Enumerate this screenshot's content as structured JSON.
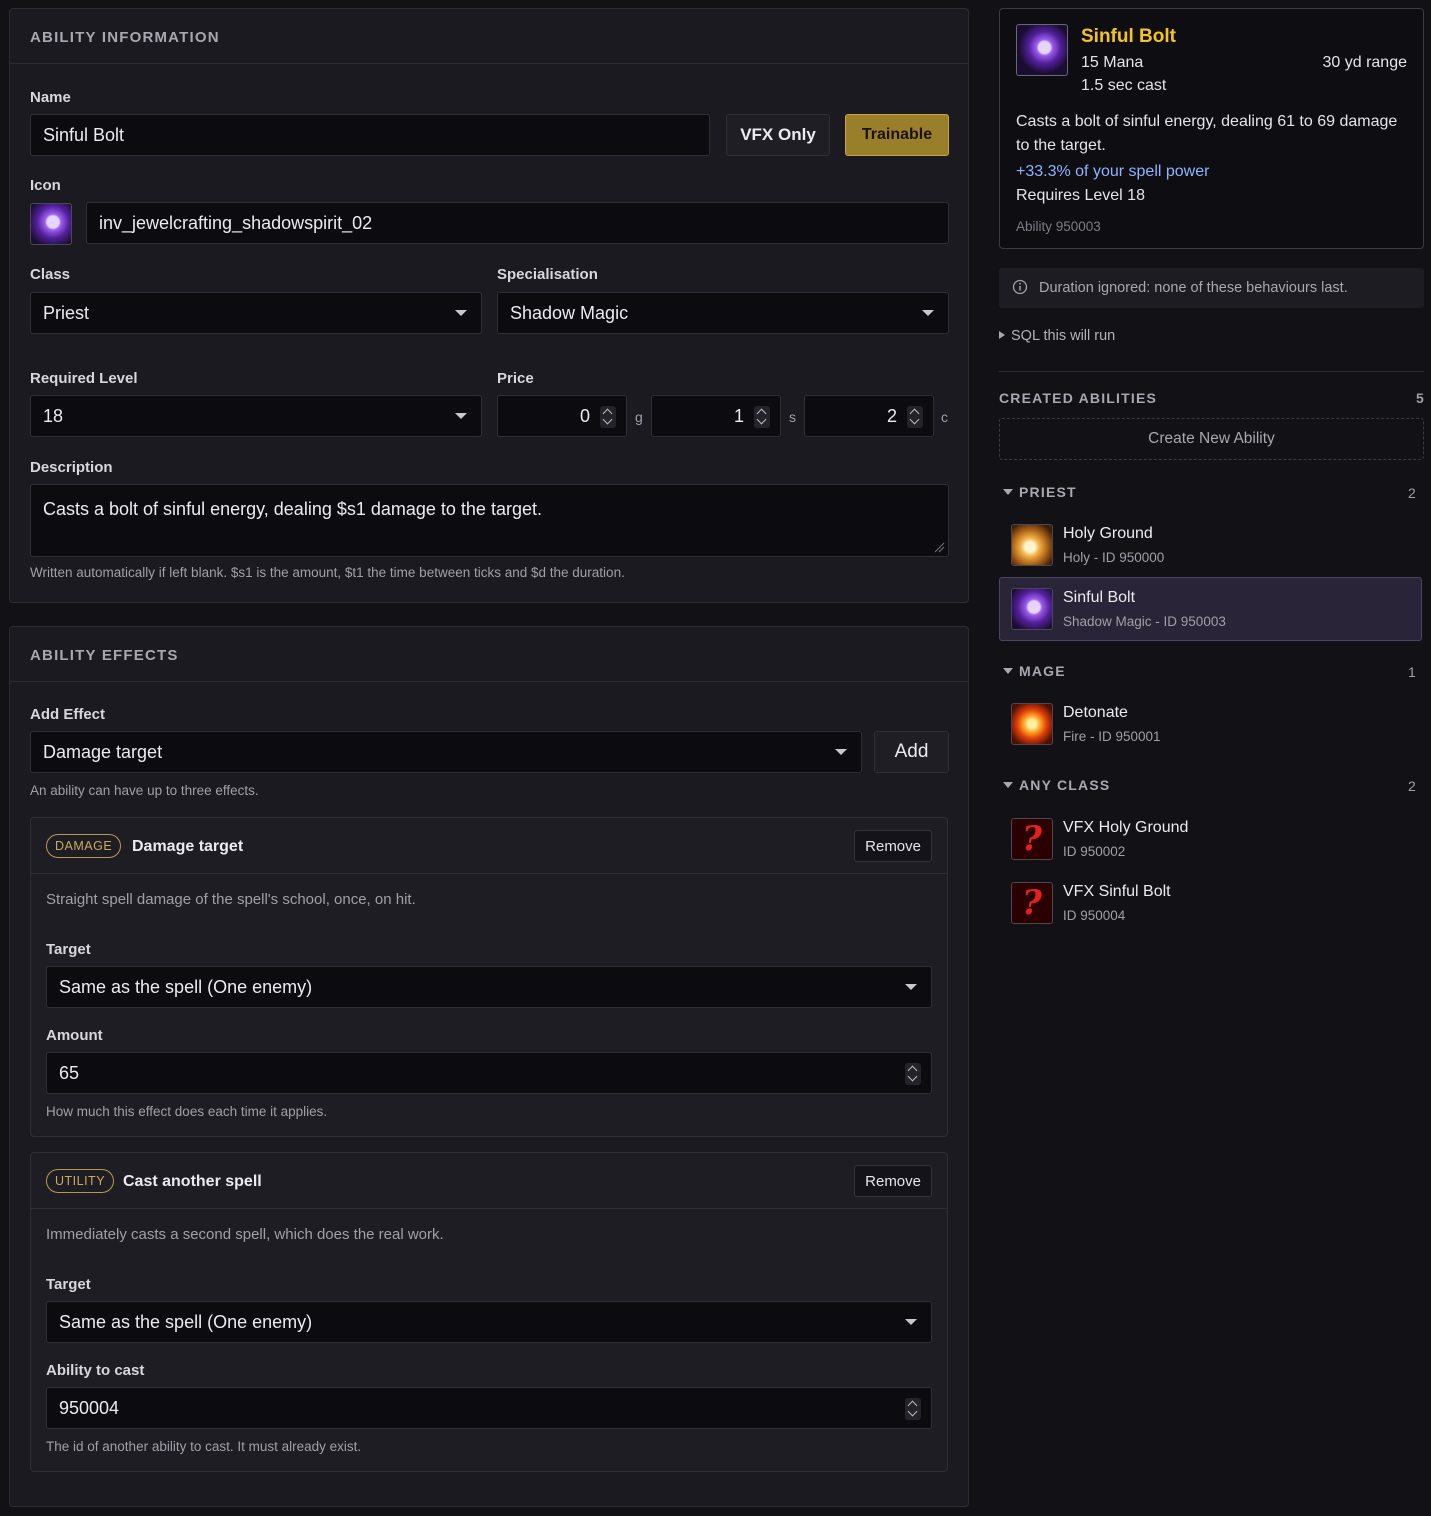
{
  "info": {
    "header": "ABILITY INFORMATION",
    "name_label": "Name",
    "name_value": "Sinful Bolt",
    "vfx_only_label": "VFX Only",
    "trainable_label": "Trainable",
    "icon_label": "Icon",
    "icon_value": "inv_jewelcrafting_shadowspirit_02",
    "class_label": "Class",
    "class_value": "Priest",
    "spec_label": "Specialisation",
    "spec_value": "Shadow Magic",
    "level_label": "Required Level",
    "level_value": "18",
    "price_label": "Price",
    "price_gold": "0",
    "price_gold_unit": "g",
    "price_silver": "1",
    "price_silver_unit": "s",
    "price_copper": "2",
    "price_copper_unit": "c",
    "desc_label": "Description",
    "desc_value": "Casts a bolt of sinful energy, dealing $s1 damage to the target.",
    "desc_hint": "Written automatically if left blank. $s1 is the amount, $t1 the time between ticks and $d the duration."
  },
  "effects": {
    "header": "ABILITY EFFECTS",
    "add_label": "Add Effect",
    "add_value": "Damage target",
    "add_button": "Add",
    "add_hint": "An ability can have up to three effects.",
    "items": [
      {
        "badge": "DAMAGE",
        "title": "Damage target",
        "remove": "Remove",
        "desc": "Straight spell damage of the spell's school, once, on hit.",
        "field1_label": "Target",
        "field1_value": "Same as the spell (One enemy)",
        "field2_label": "Amount",
        "field2_value": "65",
        "field2_hint": "How much this effect does each time it applies."
      },
      {
        "badge": "UTILITY",
        "title": "Cast another spell",
        "remove": "Remove",
        "desc": "Immediately casts a second spell, which does the real work.",
        "field1_label": "Target",
        "field1_value": "Same as the spell (One enemy)",
        "field2_label": "Ability to cast",
        "field2_value": "950004",
        "field2_hint": "The id of another ability to cast. It must already exist."
      }
    ]
  },
  "tooltip": {
    "name": "Sinful Bolt",
    "cost": "15 Mana",
    "range": "30 yd range",
    "cast": "1.5 sec cast",
    "desc": "Casts a bolt of sinful energy, dealing 61 to 69 damage to the target.",
    "bonus": "+33.3% of your spell power",
    "requires": "Requires Level 18",
    "id_text": "Ability 950003",
    "name_color": "#f5c518",
    "bonus_color": "#8fb4ff"
  },
  "notice": {
    "icon": "info-icon",
    "text": "Duration ignored: none of these behaviours last."
  },
  "sql_toggle": "SQL this will run",
  "created": {
    "header": "CREATED ABILITIES",
    "count": "5",
    "create_button": "Create New Ability",
    "groups": [
      {
        "name": "PRIEST",
        "count": "2",
        "items": [
          {
            "name": "Holy Ground",
            "sub": "Holy - ID 950000",
            "icon": "holy-ground-icon"
          },
          {
            "name": "Sinful Bolt",
            "sub": "Shadow Magic - ID 950003",
            "icon": "sinful-bolt-icon"
          }
        ]
      },
      {
        "name": "MAGE",
        "count": "1",
        "items": [
          {
            "name": "Detonate",
            "sub": "Fire - ID 950001",
            "icon": "detonate-icon"
          }
        ]
      },
      {
        "name": "ANY CLASS",
        "count": "2",
        "items": [
          {
            "name": "VFX Holy Ground",
            "sub": "ID 950002",
            "icon": "question-mark-icon"
          },
          {
            "name": "VFX Sinful Bolt",
            "sub": "ID 950004",
            "icon": "question-mark-icon"
          }
        ]
      }
    ]
  },
  "colors": {
    "accent_gold": "#b09235",
    "selected_bg": "#2a2438"
  }
}
